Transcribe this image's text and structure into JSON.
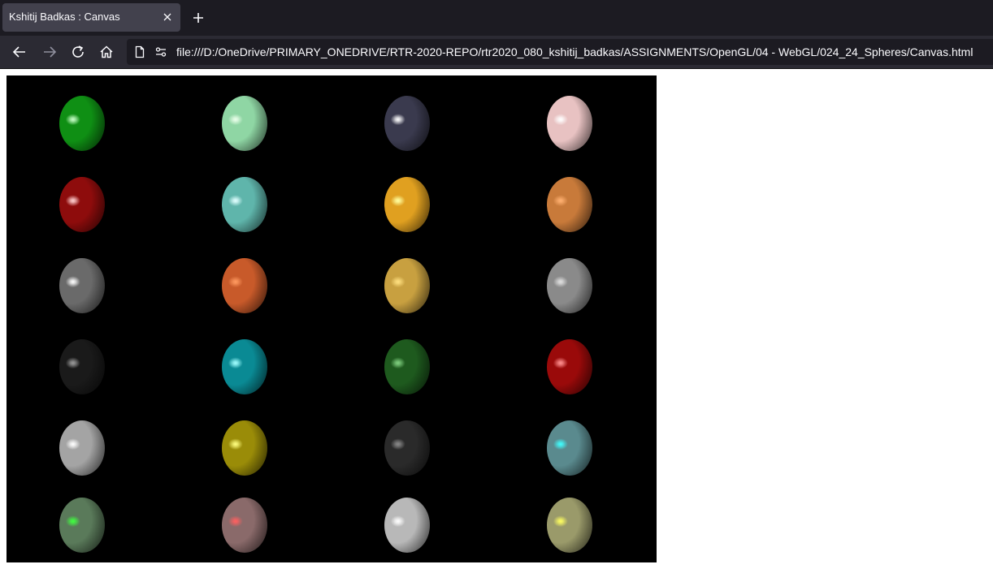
{
  "browser": {
    "tab_title": "Kshitij Badkas : Canvas",
    "url": "file:///D:/OneDrive/PRIMARY_ONEDRIVE/RTR-2020-REPO/rtr2020_080_kshitij_badkas/ASSIGNMENTS/OpenGL/04 - WebGL/024_24_Spheres/Canvas.html"
  },
  "colors": {
    "tabbar_bg": "#1c1b22",
    "active_tab_bg": "#42414d",
    "navbar_bg": "#2b2a33",
    "canvas_bg": "#000000"
  },
  "icons": [
    "close-icon",
    "plus-icon",
    "back-arrow-icon",
    "forward-arrow-icon",
    "reload-icon",
    "home-icon",
    "page-icon",
    "permissions-icon"
  ],
  "canvas": {
    "sphere_colors": [
      [
        "#0f8f14",
        "#8fd6a4",
        "#3a3a4e",
        "#e8c2c2"
      ],
      [
        "#8e0c0c",
        "#5fb5ab",
        "#e0a020",
        "#c87a3a"
      ],
      [
        "#6a6a6a",
        "#c85a2a",
        "#c8a040",
        "#8a8a8a"
      ],
      [
        "#1a1a1a",
        "#0a8a94",
        "#1e5a1e",
        "#9a0a0a"
      ],
      [
        "#a4a4a4",
        "#9a8c08",
        "#2a2a2a",
        "#5a8a8e"
      ],
      [
        "#5a7a5a",
        "#8a6a6a",
        "#b8b8b8",
        "#9a9a6a"
      ]
    ],
    "highlight_colors": [
      [
        "#c8ffc8",
        "#eaffea",
        "#ffffff",
        "#ffffff"
      ],
      [
        "#ffd0d0",
        "#e0ffff",
        "#ffffa0",
        "#ffb070"
      ],
      [
        "#ffffff",
        "#ff9a60",
        "#ffe080",
        "#e0e0e0"
      ],
      [
        "#9a9a9a",
        "#a0ffff",
        "#80d080",
        "#ff9090"
      ],
      [
        "#ffffff",
        "#ffff80",
        "#8a8a8a",
        "#40ffff"
      ],
      [
        "#40ff40",
        "#ff6060",
        "#ffffff",
        "#ffff60"
      ]
    ]
  }
}
